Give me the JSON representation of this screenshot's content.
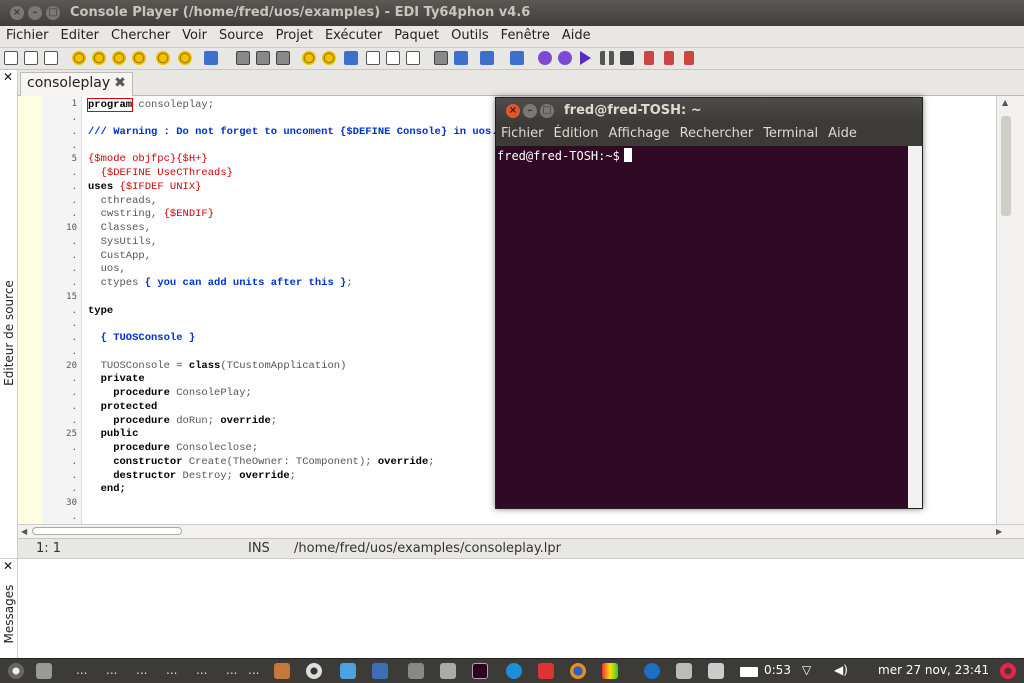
{
  "window": {
    "title": "Console Player (/home/fred/uos/examples) - EDI Ty64phon v4.6"
  },
  "menu": [
    "Fichier",
    "Editer",
    "Chercher",
    "Voir",
    "Source",
    "Projet",
    "Exécuter",
    "Paquet",
    "Outils",
    "Fenêtre",
    "Aide"
  ],
  "side_panel": {
    "label": "Editeur de source",
    "close": "✕"
  },
  "tab": {
    "label": "consoleplay",
    "close": "✖"
  },
  "line_numbers": [
    "1",
    ".",
    ".",
    ".",
    "5",
    ".",
    ".",
    ".",
    ".",
    "10",
    ".",
    ".",
    ".",
    ".",
    "15",
    ".",
    ".",
    ".",
    ".",
    "20",
    ".",
    ".",
    ".",
    ".",
    "25",
    ".",
    ".",
    ".",
    ".",
    "30",
    "."
  ],
  "code": {
    "l1_kw": "program",
    "l1_rest": " consoleplay;",
    "l3": "/// Warning : Do not forget to uncoment {$DEFINE Console} in uos.pas",
    "l5_a": "{$mode objfpc}",
    "l5_b": "{$H+}",
    "l6": "  {$DEFINE UseCThreads}",
    "l7_kw": "uses",
    "l7_dir": " {$IFDEF UNIX}",
    "l8": "  cthreads,",
    "l9_a": "  cwstring, ",
    "l9_dir": "{$ENDIF}",
    "l10": "  Classes,",
    "l11": "  SysUtils,",
    "l12": "  CustApp,",
    "l13": "  uos,",
    "l14_a": "  ctypes ",
    "l14_cm": "{ you can add units after this }",
    "l14_b": ";",
    "l16": "type",
    "l18": "  { TUOSConsole }",
    "l20_a": "  TUOSConsole ",
    "l20_eq": "=",
    "l20_kw": " class",
    "l20_b": "(TCustomApplication)",
    "l21": "  private",
    "l22_kw": "    procedure",
    "l22_b": " ConsolePlay;",
    "l23": "  protected",
    "l24_kw": "    procedure",
    "l24_b": " doRun; ",
    "l24_kw2": "override",
    "l24_c": ";",
    "l25": "  public",
    "l26_kw": "    procedure",
    "l26_b": " Consoleclose;",
    "l27_kw": "    constructor",
    "l27_b": " Create(TheOwner: TComponent); ",
    "l27_kw2": "override",
    "l27_c": ";",
    "l28_kw": "    destructor",
    "l28_b": " Destroy; ",
    "l28_kw2": "override",
    "l28_c": ";",
    "l29": "  end;"
  },
  "status": {
    "position": "1:  1",
    "mode": "INS",
    "path": "/home/fred/uos/examples/consoleplay.lpr"
  },
  "messages_panel": {
    "label": "Messages",
    "close": "✕"
  },
  "terminal": {
    "title": "fred@fred-TOSH: ~",
    "menu": [
      "Fichier",
      "Édition",
      "Affichage",
      "Rechercher",
      "Terminal",
      "Aide"
    ],
    "prompt": "fred@fred-TOSH:~$"
  },
  "panel": {
    "battery_time": "0:53",
    "clock": "mer 27 nov, 23:41",
    "dots": "..."
  }
}
